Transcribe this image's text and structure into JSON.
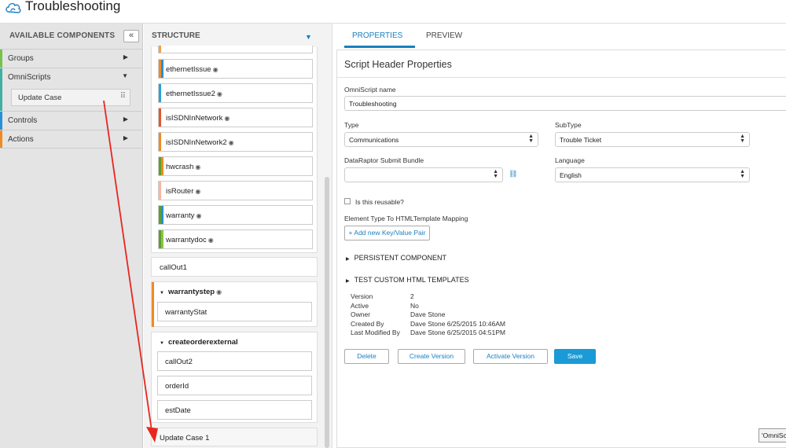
{
  "app": {
    "title": "Troubleshooting"
  },
  "left_panel": {
    "title": "AVAILABLE COMPONENTS",
    "collapse_glyph": "«",
    "categories": [
      {
        "label": "Groups",
        "color": "#77c24a"
      },
      {
        "label": "OmniScripts",
        "color": "#3fb0a3",
        "component": "Update Case"
      },
      {
        "label": "Controls",
        "color": "#2a8fd6"
      },
      {
        "label": "Actions",
        "color": "#f08a24"
      }
    ]
  },
  "structure": {
    "title": "STRUCTURE",
    "items": [
      {
        "label": "ethernetIssue"
      },
      {
        "label": "ethernetIssue2"
      },
      {
        "label": "isISDNInNetwork"
      },
      {
        "label": "isISDNInNetwork2"
      },
      {
        "label": "hwcrash"
      },
      {
        "label": "isRouter"
      },
      {
        "label": "warranty"
      },
      {
        "label": "warrantydoc"
      }
    ],
    "callout1": "callOut1",
    "warranty_step": {
      "title": "warrantystep",
      "child": "warrantyStat"
    },
    "create_order": {
      "title": "createorderexternal",
      "children": [
        "callOut2",
        "orderId",
        "estDate"
      ]
    },
    "dropped": "Update Case 1"
  },
  "tabs": {
    "properties": "PROPERTIES",
    "preview": "PREVIEW"
  },
  "props": {
    "heading": "Script Header Properties",
    "name_label": "OmniScript name",
    "name_value": "Troubleshooting",
    "type_label": "Type",
    "type_value": "Communications",
    "subtype_label": "SubType",
    "subtype_value": "Trouble Ticket",
    "bundle_label": "DataRaptor Submit Bundle",
    "bundle_value": "",
    "language_label": "Language",
    "language_value": "English",
    "reusable_label": "Is this reusable?",
    "mapping_label": "Element Type To HTMLTemplate Mapping",
    "add_pair": "+ Add new Key/Value Pair",
    "section1": "PERSISTENT COMPONENT",
    "section2": "TEST CUSTOM HTML TEMPLATES",
    "meta_labels": [
      "Version",
      "Active",
      "Owner",
      "Created By",
      "Last Modified By"
    ],
    "meta_values": [
      "2",
      "No",
      "Dave Stone",
      "Dave Stone 6/25/2015 10:46AM",
      "Dave Stone 6/25/2015 04:51PM"
    ],
    "buttons": {
      "delete": "Delete",
      "create_version": "Create Version",
      "activate_version": "Activate Version",
      "save": "Save"
    }
  },
  "tooltip": "'OmniSc"
}
